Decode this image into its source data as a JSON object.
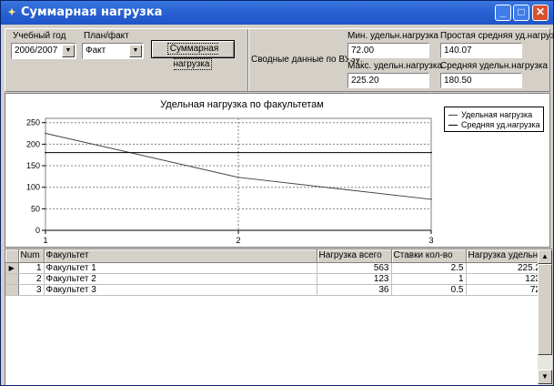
{
  "window": {
    "title": "Суммарная нагрузка",
    "icon": "app-icon",
    "minimize": "_",
    "maximize": "□",
    "close": "✕"
  },
  "toolbar": {
    "year_label": "Учебный год",
    "year_value": "2006/2007",
    "plan_label": "План/факт",
    "plan_value": "Факт",
    "summary_button": "Суммарная нагрузка",
    "summary_caption": "Сводные данные по ВУЗу:",
    "min_label": "Мин. удельн.нагрузка",
    "min_value": "72.00",
    "max_label": "Макс. удельн.нагрузка",
    "max_value": "225.20",
    "simple_avg_label": "Простая средняя уд.нагрузка",
    "simple_avg_value": "140.07",
    "avg_label": "Средняя удельн.нагрузка",
    "avg_value": "180.50"
  },
  "chart_data": {
    "type": "line",
    "title": "Удельная нагрузка по факультетам",
    "x": [
      1,
      2,
      3
    ],
    "xlim": [
      1,
      3
    ],
    "ylim": [
      0,
      260
    ],
    "yticks": [
      0,
      50,
      100,
      150,
      200,
      250
    ],
    "xticks": [
      1,
      2,
      3
    ],
    "grid": true,
    "legend_position": "top-right",
    "series": [
      {
        "name": "Удельная нагрузка",
        "values": [
          225.2,
          123,
          72
        ],
        "color": "#404040"
      },
      {
        "name": "Средняя уд.нагрузка",
        "values": [
          180.5,
          180.5,
          180.5
        ],
        "color": "#000000"
      }
    ]
  },
  "grid": {
    "columns": [
      "Num",
      "Факультет",
      "Нагрузка всего",
      "Ставки кол-во",
      "Нагрузка удельн."
    ],
    "rows": [
      {
        "num": "1",
        "faculty": "Факультет 1",
        "total": "563",
        "rates": "2.5",
        "specific": "225.2"
      },
      {
        "num": "2",
        "faculty": "Факультет 2",
        "total": "123",
        "rates": "1",
        "specific": "123"
      },
      {
        "num": "3",
        "faculty": "Факультет 3",
        "total": "36",
        "rates": "0.5",
        "specific": "72"
      }
    ],
    "current_row_marker": "▶",
    "scroll_up": "▲",
    "scroll_down": "▼"
  }
}
